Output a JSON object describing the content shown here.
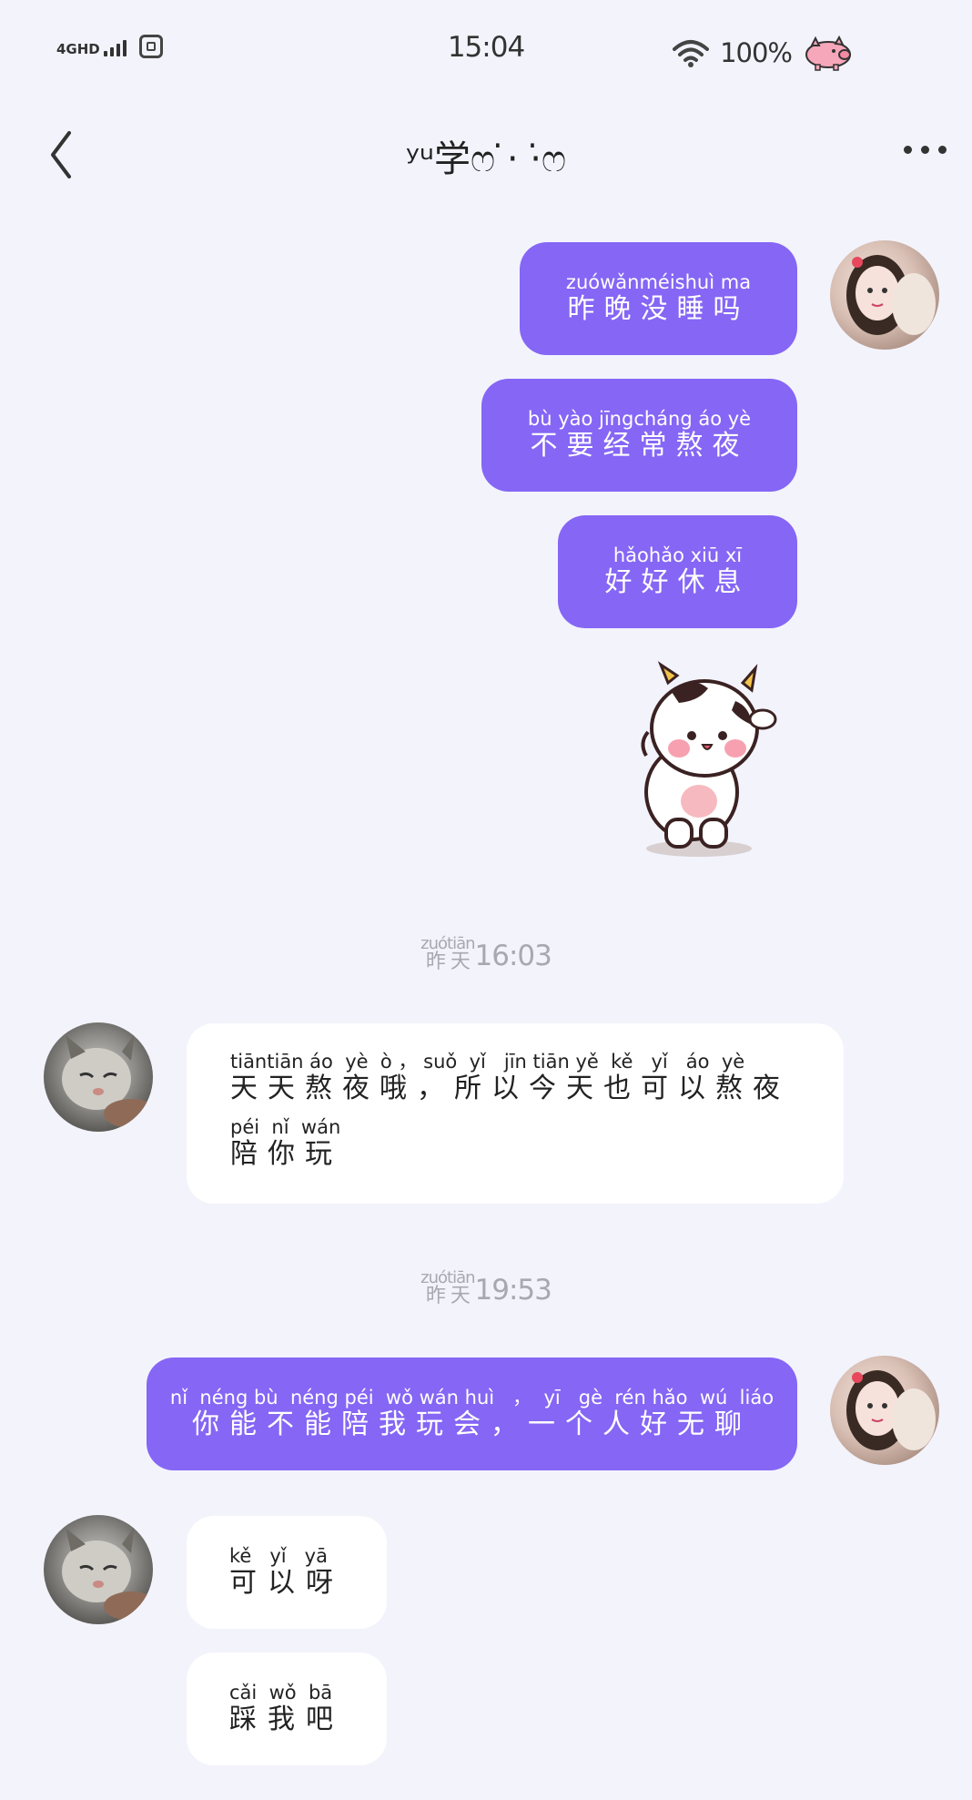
{
  "status_bar": {
    "network": "4GHD",
    "time": "15:04",
    "battery": "100%"
  },
  "header": {
    "title": "ʸᵘ学ෆ ̇·  ·̇ෆ"
  },
  "messages": {
    "m1": {
      "pinyin": "zuówǎnméishuì ma",
      "text": "昨晚没睡吗"
    },
    "m2": {
      "pinyin": "bù yào jīngcháng áo  yè",
      "text": "不要经常熬夜"
    },
    "m3": {
      "pinyin": "hǎohǎo xiū  xī",
      "text": "好好休息"
    },
    "ts1": {
      "pinyin": "zuótiān",
      "label": "昨 天",
      "time": "16:03"
    },
    "m4": {
      "line1_pinyin": "tiāntiān áo  yè  ò ， suǒ  yǐ   jīn tiān yě  kě   yǐ   áo  yè",
      "line1_text": "天天熬夜哦，所以今天也可以熬夜",
      "line2_pinyin": "péi  nǐ  wán",
      "line2_text": "陪你玩"
    },
    "ts2": {
      "pinyin": "zuótiān",
      "label": "昨 天",
      "time": "19:53"
    },
    "m5": {
      "pinyin": "nǐ  néng bù  néng péi  wǒ wán huì   ，  yī   gè  rén hǎo  wú  liáo",
      "text": "你能不能陪我玩会，一个人好无聊"
    },
    "m6": {
      "pinyin": "kě   yǐ   yā",
      "text": "可以呀"
    },
    "m7": {
      "pinyin": "cǎi  wǒ  bā",
      "text": "踩我吧"
    }
  }
}
